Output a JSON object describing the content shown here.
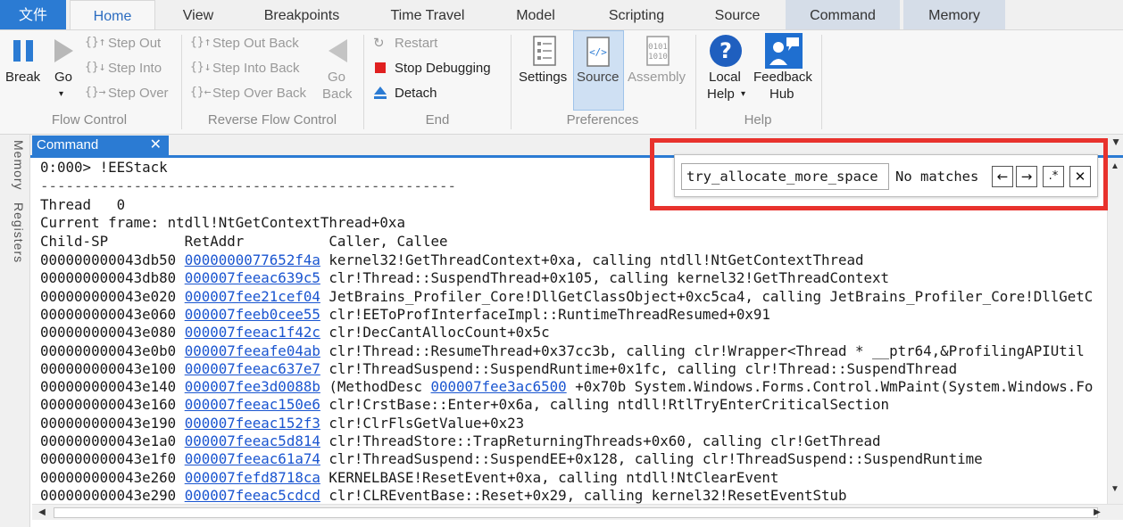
{
  "tabs": {
    "file": "文件",
    "home": "Home",
    "view": "View",
    "breakpoints": "Breakpoints",
    "time_travel": "Time Travel",
    "model": "Model",
    "scripting": "Scripting",
    "source": "Source",
    "command": "Command",
    "memory": "Memory"
  },
  "ribbon": {
    "flow_control": {
      "label": "Flow Control",
      "break": "Break",
      "go": "Go",
      "step_out": "Step Out",
      "step_into": "Step Into",
      "step_over": "Step Over"
    },
    "reverse_flow_control": {
      "label": "Reverse Flow Control",
      "step_out_back": "Step Out Back",
      "step_into_back": "Step Into Back",
      "step_over_back": "Step Over Back",
      "go_back_1": "Go",
      "go_back_2": "Back"
    },
    "end": {
      "label": "End",
      "restart": "Restart",
      "stop_debugging": "Stop Debugging",
      "detach": "Detach"
    },
    "preferences": {
      "label": "Preferences",
      "settings": "Settings",
      "source": "Source",
      "assembly": "Assembly"
    },
    "help": {
      "label": "Help",
      "local_help_1": "Local",
      "local_help_2": "Help",
      "feedback_hub_1": "Feedback",
      "feedback_hub_2": "Hub"
    }
  },
  "rail": {
    "memory": "Memory",
    "registers": "Registers"
  },
  "command_window": {
    "title": "Command",
    "prompt": "0:000> !EEStack",
    "divider": "-------------------------------------------------",
    "thread": "Thread   0",
    "current_frame": "Current frame: ntdll!NtGetContextThread+0xa",
    "header": "Child-SP         RetAddr          Caller, Callee",
    "rows": [
      {
        "sp": "000000000043db50",
        "ret": "0000000077652f4a",
        "text": "kernel32!GetThreadContext+0xa, calling ntdll!NtGetContextThread"
      },
      {
        "sp": "000000000043db80",
        "ret": "000007feeac639c5",
        "text": "clr!Thread::SuspendThread+0x105, calling kernel32!GetThreadContext"
      },
      {
        "sp": "000000000043e020",
        "ret": "000007fee21cef04",
        "text": "JetBrains_Profiler_Core!DllGetClassObject+0xc5ca4, calling JetBrains_Profiler_Core!DllGetC"
      },
      {
        "sp": "000000000043e060",
        "ret": "000007feeb0cee55",
        "text": "clr!EEToProfInterfaceImpl::RuntimeThreadResumed+0x91"
      },
      {
        "sp": "000000000043e080",
        "ret": "000007feeac1f42c",
        "text": "clr!DecCantAllocCount+0x5c"
      },
      {
        "sp": "000000000043e0b0",
        "ret": "000007feeafe04ab",
        "text": "clr!Thread::ResumeThread+0x37cc3b, calling clr!Wrapper<Thread * __ptr64,&ProfilingAPIUtil"
      },
      {
        "sp": "000000000043e100",
        "ret": "000007feeac637e7",
        "text": "clr!ThreadSuspend::SuspendRuntime+0x1fc, calling clr!Thread::SuspendThread"
      },
      {
        "sp": "000000000043e140",
        "ret": "000007fee3d0088b",
        "pre": "(MethodDesc ",
        "link2": "000007fee3ac6500",
        "text": " +0x70b System.Windows.Forms.Control.WmPaint(System.Windows.Fo"
      },
      {
        "sp": "000000000043e160",
        "ret": "000007feeac150e6",
        "text": "clr!CrstBase::Enter+0x6a, calling ntdll!RtlTryEnterCriticalSection"
      },
      {
        "sp": "000000000043e190",
        "ret": "000007feeac152f3",
        "text": "clr!ClrFlsGetValue+0x23"
      },
      {
        "sp": "000000000043e1a0",
        "ret": "000007feeac5d814",
        "text": "clr!ThreadStore::TrapReturningThreads+0x60, calling clr!GetThread"
      },
      {
        "sp": "000000000043e1f0",
        "ret": "000007feeac61a74",
        "text": "clr!ThreadSuspend::SuspendEE+0x128, calling clr!ThreadSuspend::SuspendRuntime"
      },
      {
        "sp": "000000000043e260",
        "ret": "000007fefd8718ca",
        "text": "KERNELBASE!ResetEvent+0xa, calling ntdll!NtClearEvent"
      },
      {
        "sp": "000000000043e290",
        "ret": "000007feeac5cdcd",
        "text": "clr!CLREventBase::Reset+0x29, calling kernel32!ResetEventStub"
      }
    ]
  },
  "find": {
    "query": "try_allocate_more_space",
    "status": "No matches"
  }
}
